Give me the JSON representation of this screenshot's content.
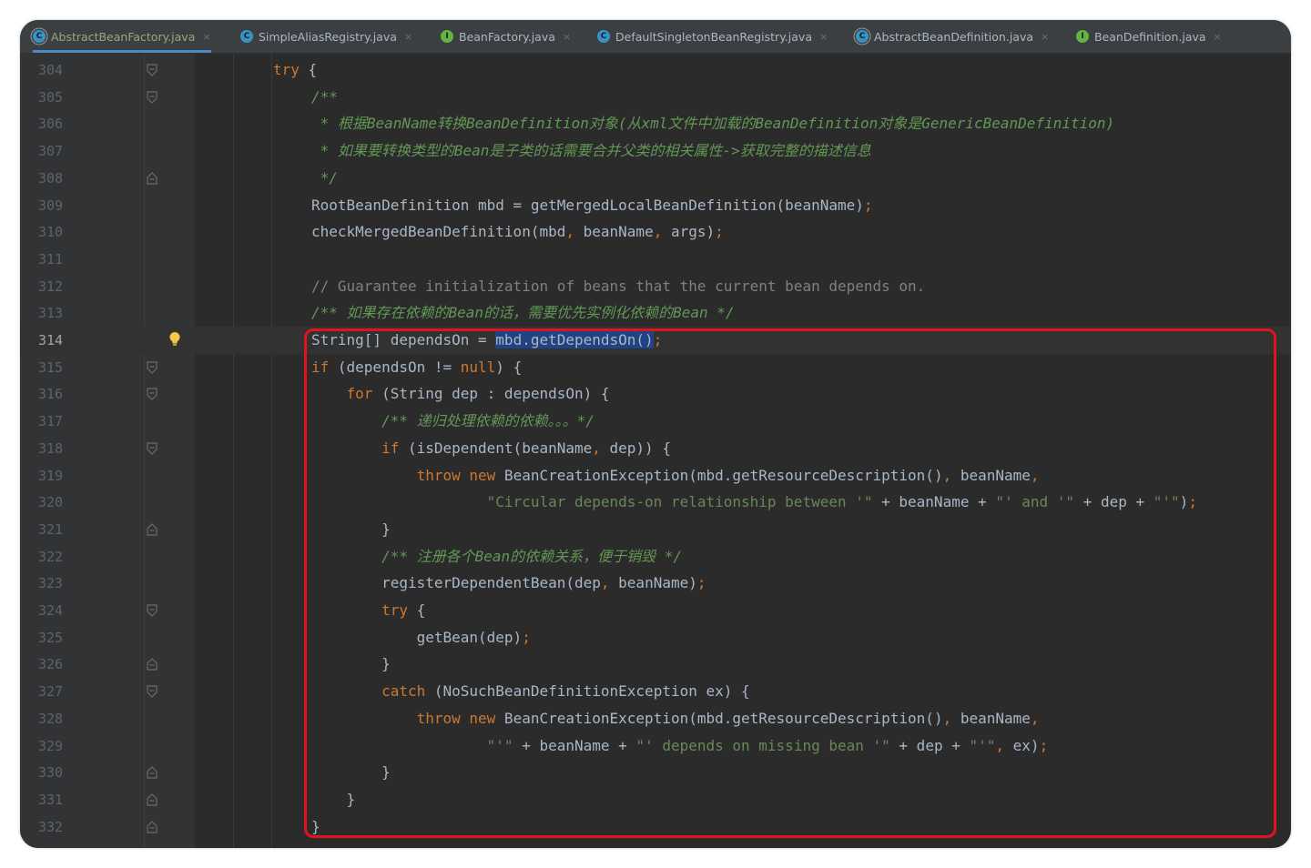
{
  "tabs": [
    {
      "label": "AbstractBeanFactory.java",
      "icon": "abstract-class-icon",
      "active": true
    },
    {
      "label": "SimpleAliasRegistry.java",
      "icon": "class-icon",
      "active": false
    },
    {
      "label": "BeanFactory.java",
      "icon": "interface-icon",
      "active": false
    },
    {
      "label": "DefaultSingletonBeanRegistry.java",
      "icon": "class-icon",
      "active": false
    },
    {
      "label": "AbstractBeanDefinition.java",
      "icon": "abstract-class-icon",
      "active": false
    },
    {
      "label": "BeanDefinition.java",
      "icon": "interface-icon",
      "active": false
    }
  ],
  "tab_close_glyph": "×",
  "current_line": 314,
  "colors": {
    "editor_bg": "#2b2b2b",
    "keyword": "#cc7832",
    "doc_comment": "#629755",
    "string": "#6a8759",
    "highlight_box": "#e0141f",
    "selection": "#214283"
  },
  "lines": [
    {
      "num": "304",
      "tokens": [
        [
          "kw",
          "try"
        ],
        [
          "br",
          " {"
        ]
      ]
    },
    {
      "num": "305",
      "tokens": [
        [
          "cm",
          "/**"
        ]
      ]
    },
    {
      "num": "306",
      "tokens": [
        [
          "cm",
          " * 根据BeanName转换BeanDefinition对象(从xml文件中加载的BeanDefinition对象是GenericBeanDefinition)"
        ]
      ]
    },
    {
      "num": "307",
      "tokens": [
        [
          "cm",
          " * 如果要转换类型的Bean是子类的话需要合并父类的相关属性->获取完整的描述信息"
        ]
      ]
    },
    {
      "num": "308",
      "tokens": [
        [
          "cm",
          " */"
        ]
      ]
    },
    {
      "num": "309",
      "tokens": [
        [
          "br",
          "RootBeanDefinition mbd = getMergedLocalBeanDefinition(beanName)"
        ],
        [
          "pn",
          ";"
        ]
      ]
    },
    {
      "num": "310",
      "tokens": [
        [
          "br",
          "checkMergedBeanDefinition(mbd"
        ],
        [
          "pn",
          ","
        ],
        [
          "br",
          " beanName"
        ],
        [
          "pn",
          ","
        ],
        [
          "br",
          " args)"
        ],
        [
          "pn",
          ";"
        ]
      ]
    },
    {
      "num": "311",
      "tokens": []
    },
    {
      "num": "312",
      "tokens": [
        [
          "lc",
          "// Guarantee initialization of beans that the current bean depends on."
        ]
      ]
    },
    {
      "num": "313",
      "tokens": [
        [
          "cm",
          "/** 如果存在依赖的Bean的话，需要优先实例化依赖的Bean */"
        ]
      ]
    },
    {
      "num": "314",
      "tokens": [
        [
          "br",
          "String[] dependsOn = "
        ],
        [
          "sel",
          "mbd.getDependsOn()"
        ],
        [
          "pn",
          ";"
        ]
      ]
    },
    {
      "num": "315",
      "tokens": [
        [
          "kw",
          "if"
        ],
        [
          "br",
          " (dependsOn != "
        ],
        [
          "kw",
          "null"
        ],
        [
          "br",
          ") {"
        ]
      ]
    },
    {
      "num": "316",
      "tokens": [
        [
          "br",
          "    "
        ],
        [
          "kw",
          "for"
        ],
        [
          "br",
          " (String dep : dependsOn) {"
        ]
      ]
    },
    {
      "num": "317",
      "tokens": [
        [
          "br",
          "        "
        ],
        [
          "cm",
          "/** 递归处理依赖的依赖。。。*/"
        ]
      ]
    },
    {
      "num": "318",
      "tokens": [
        [
          "br",
          "        "
        ],
        [
          "kw",
          "if"
        ],
        [
          "br",
          " (isDependent(beanName"
        ],
        [
          "pn",
          ","
        ],
        [
          "br",
          " dep)) {"
        ]
      ]
    },
    {
      "num": "319",
      "tokens": [
        [
          "br",
          "            "
        ],
        [
          "kw",
          "throw new"
        ],
        [
          "br",
          " BeanCreationException(mbd.getResourceDescription()"
        ],
        [
          "pn",
          ","
        ],
        [
          "br",
          " beanName"
        ],
        [
          "pn",
          ","
        ]
      ]
    },
    {
      "num": "320",
      "tokens": [
        [
          "br",
          "                    "
        ],
        [
          "st",
          "\"Circular depends-on relationship between '\""
        ],
        [
          "br",
          " + beanName + "
        ],
        [
          "st",
          "\"' and '\""
        ],
        [
          "br",
          " + dep + "
        ],
        [
          "st",
          "\"'\""
        ],
        [
          "br",
          ")"
        ],
        [
          "pn",
          ";"
        ]
      ]
    },
    {
      "num": "321",
      "tokens": [
        [
          "br",
          "        }"
        ]
      ]
    },
    {
      "num": "322",
      "tokens": [
        [
          "br",
          "        "
        ],
        [
          "cm",
          "/** 注册各个Bean的依赖关系，便于销毁 */"
        ]
      ]
    },
    {
      "num": "323",
      "tokens": [
        [
          "br",
          "        registerDependentBean(dep"
        ],
        [
          "pn",
          ","
        ],
        [
          "br",
          " beanName)"
        ],
        [
          "pn",
          ";"
        ]
      ]
    },
    {
      "num": "324",
      "tokens": [
        [
          "br",
          "        "
        ],
        [
          "kw",
          "try"
        ],
        [
          "br",
          " {"
        ]
      ]
    },
    {
      "num": "325",
      "tokens": [
        [
          "br",
          "            getBean(dep)"
        ],
        [
          "pn",
          ";"
        ]
      ]
    },
    {
      "num": "326",
      "tokens": [
        [
          "br",
          "        }"
        ]
      ]
    },
    {
      "num": "327",
      "tokens": [
        [
          "br",
          "        "
        ],
        [
          "kw",
          "catch"
        ],
        [
          "br",
          " (NoSuchBeanDefinitionException ex) {"
        ]
      ]
    },
    {
      "num": "328",
      "tokens": [
        [
          "br",
          "            "
        ],
        [
          "kw",
          "throw new"
        ],
        [
          "br",
          " BeanCreationException(mbd.getResourceDescription()"
        ],
        [
          "pn",
          ","
        ],
        [
          "br",
          " beanName"
        ],
        [
          "pn",
          ","
        ]
      ]
    },
    {
      "num": "329",
      "tokens": [
        [
          "br",
          "                    "
        ],
        [
          "st",
          "\"'\""
        ],
        [
          "br",
          " + beanName + "
        ],
        [
          "st",
          "\"' depends on missing bean '\""
        ],
        [
          "br",
          " + dep + "
        ],
        [
          "st",
          "\"'\""
        ],
        [
          "pn",
          ","
        ],
        [
          "br",
          " ex)"
        ],
        [
          "pn",
          ";"
        ]
      ]
    },
    {
      "num": "330",
      "tokens": [
        [
          "br",
          "        }"
        ]
      ]
    },
    {
      "num": "331",
      "tokens": [
        [
          "br",
          "    }"
        ]
      ]
    },
    {
      "num": "332",
      "tokens": [
        [
          "br",
          "}"
        ]
      ]
    }
  ]
}
